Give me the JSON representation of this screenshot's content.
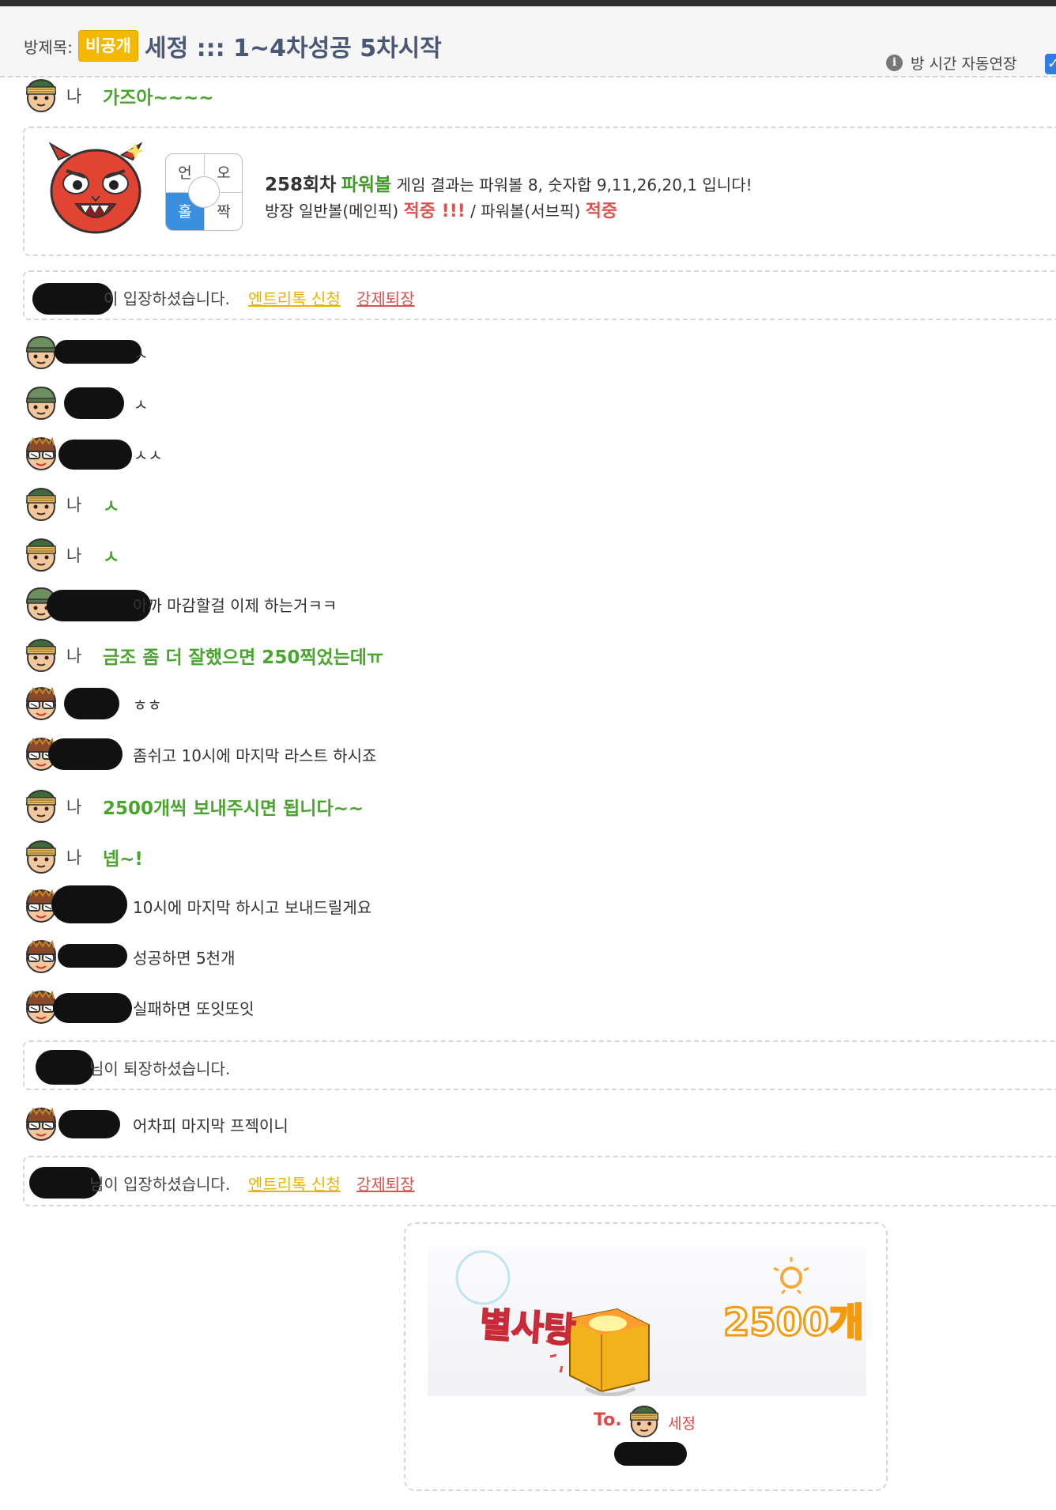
{
  "header": {
    "label": "방제목:",
    "badge": "비공개",
    "title": "세정 ::: 1~4차성공 5차시작",
    "auto_extend": "방 시간 자동연장",
    "info_icon": "info-icon",
    "checkbox_checked": true
  },
  "me_label": "나",
  "messages": {
    "m1": "가즈아~~~~",
    "m2": "ㅅ",
    "m3": "ㅅ",
    "m4": "ㅅㅅ",
    "m5": "ㅅ",
    "m6": "ㅅ",
    "m7": "아까 마감할걸 이제 하는거ㅋㅋ",
    "m8": "금조 좀 더 잘했으면 250찍었는데ㅠ",
    "m9": "ㅎㅎ",
    "m10": "좀쉬고 10시에 마지막 라스트 하시죠",
    "m11": "2500개씩 보내주시면 됩니다~~",
    "m12": "넵~!",
    "m13": "10시에 마지막 하시고 보내드릴게요",
    "m14": "성공하면 5천개",
    "m15": "실패하면 또잇또잇",
    "m16": "어차피 마지막 프젝이니"
  },
  "result": {
    "round": "258회차",
    "game": "파워볼",
    "text1": "게임 결과는 파워볼 8, 숫자합 9,11,26,20,1 입니다!",
    "text2a": "방장 일반볼(메인픽)",
    "hit1": "적중 !!!",
    "text2b": "/ 파워볼(서브픽)",
    "hit2": "적중",
    "grid": [
      "언",
      "오",
      "홀",
      "짝"
    ]
  },
  "system": {
    "enter1": "이 입장하셨습니다.",
    "leave": "님이 퇴장하셨습니다.",
    "enter2": "님이 입장하셨습니다.",
    "entry_link": "엔트리톡 신청",
    "kick_link": "강제퇴장"
  },
  "gift": {
    "brand": "별사탕",
    "count": "2500개",
    "to": "To.",
    "recipient": "세정"
  }
}
